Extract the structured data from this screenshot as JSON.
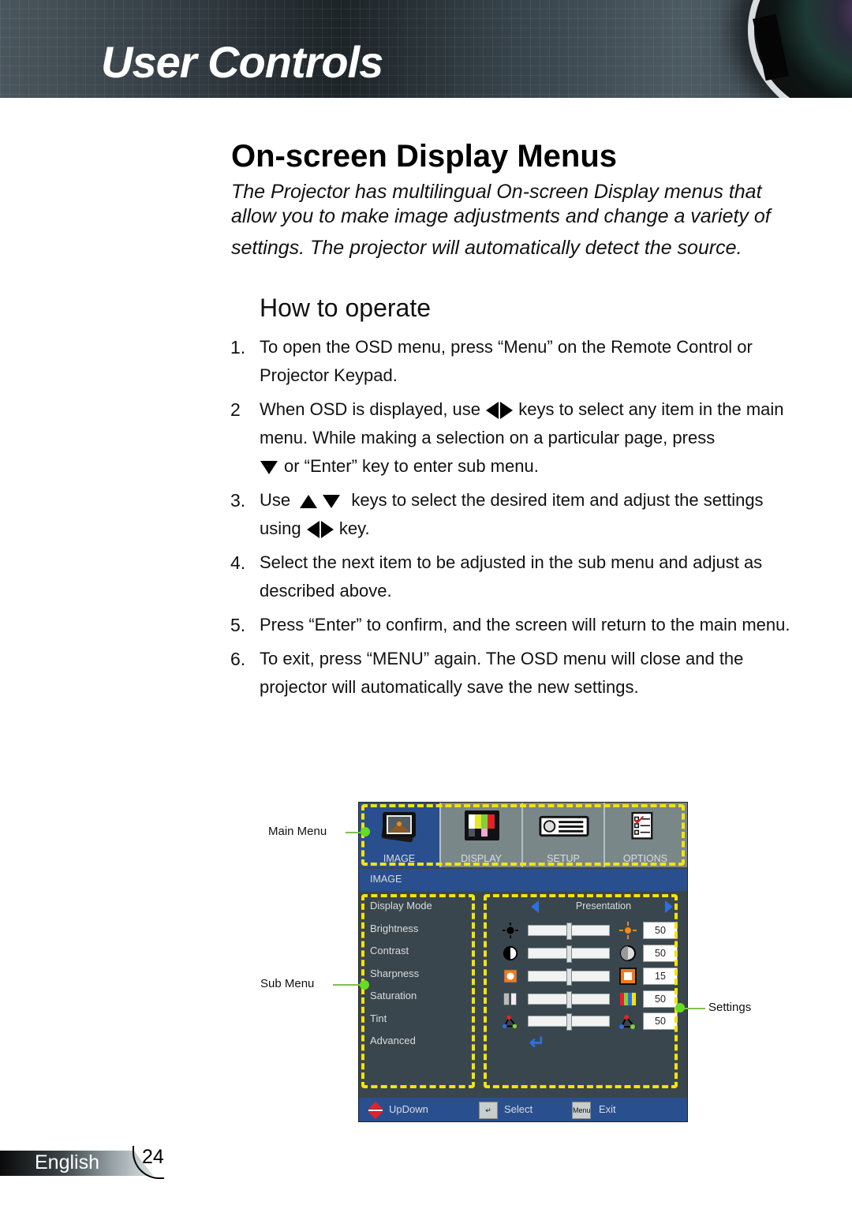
{
  "header": {
    "title": "User Controls"
  },
  "section": {
    "title": "On-screen Display Menus",
    "intro_line1": "The Projector has multilingual On-screen Display menus that",
    "intro_line2": "allow you to make image adjustments and change a variety of",
    "intro_line3": "settings. The projector will automatically detect the source."
  },
  "howto": {
    "title": "How to operate",
    "steps": [
      {
        "num": "1.",
        "text": "To open the OSD menu, press “Menu” on the Remote Control or Projector Keypad."
      },
      {
        "num": "2",
        "text_a": "When OSD is displayed, use",
        "text_b": "keys to select any item in the main menu. While making a selection on a particular page, press",
        "text_c": "or “Enter” key to enter sub menu."
      },
      {
        "num": "3.",
        "text_a": "Use",
        "text_b": "keys to select the desired item and adjust the settings using",
        "text_c": "key."
      },
      {
        "num": "4.",
        "text": "Select the next item to be adjusted in the sub menu and adjust as described above."
      },
      {
        "num": "5.",
        "text": "Press “Enter” to confirm, and the screen will return to the main menu."
      },
      {
        "num": "6.",
        "text": "To exit, press “MENU” again. The OSD menu will close and the projector will automatically save the new settings."
      }
    ]
  },
  "osd": {
    "tabs": [
      {
        "label": "IMAGE",
        "icon": "image-icon",
        "active": true
      },
      {
        "label": "DISPLAY",
        "icon": "color-bars-icon",
        "active": false
      },
      {
        "label": "SETUP",
        "icon": "projector-icon",
        "active": false
      },
      {
        "label": "OPTIONS",
        "icon": "checklist-icon",
        "active": false
      }
    ],
    "breadcrumb": "IMAGE",
    "submenu": [
      "Display Mode",
      "Brightness",
      "Contrast",
      "Sharpness",
      "Saturation",
      "Tint",
      "Advanced"
    ],
    "display_mode_value": "Presentation",
    "settings": [
      {
        "name": "Brightness",
        "value": "50",
        "level": 0.5,
        "icon": "brightness-icon"
      },
      {
        "name": "Contrast",
        "value": "50",
        "level": 0.5,
        "icon": "contrast-icon"
      },
      {
        "name": "Sharpness",
        "value": "15",
        "level": 0.5,
        "icon": "sharpness-icon"
      },
      {
        "name": "Saturation",
        "value": "50",
        "level": 0.5,
        "icon": "saturation-icon"
      },
      {
        "name": "Tint",
        "value": "50",
        "level": 0.5,
        "icon": "tint-icon"
      }
    ],
    "footer": {
      "updown": "UpDown",
      "select": "Select",
      "exit": "Exit",
      "menu_key": "Menu"
    },
    "colors": {
      "active_blue": "#2a4f8f",
      "highlight_yellow": "#f3e30c",
      "callout_green": "#66dd22"
    }
  },
  "callouts": {
    "main_menu": "Main Menu",
    "sub_menu": "Sub Menu",
    "settings": "Settings"
  },
  "footer": {
    "language": "English",
    "page": "24"
  }
}
